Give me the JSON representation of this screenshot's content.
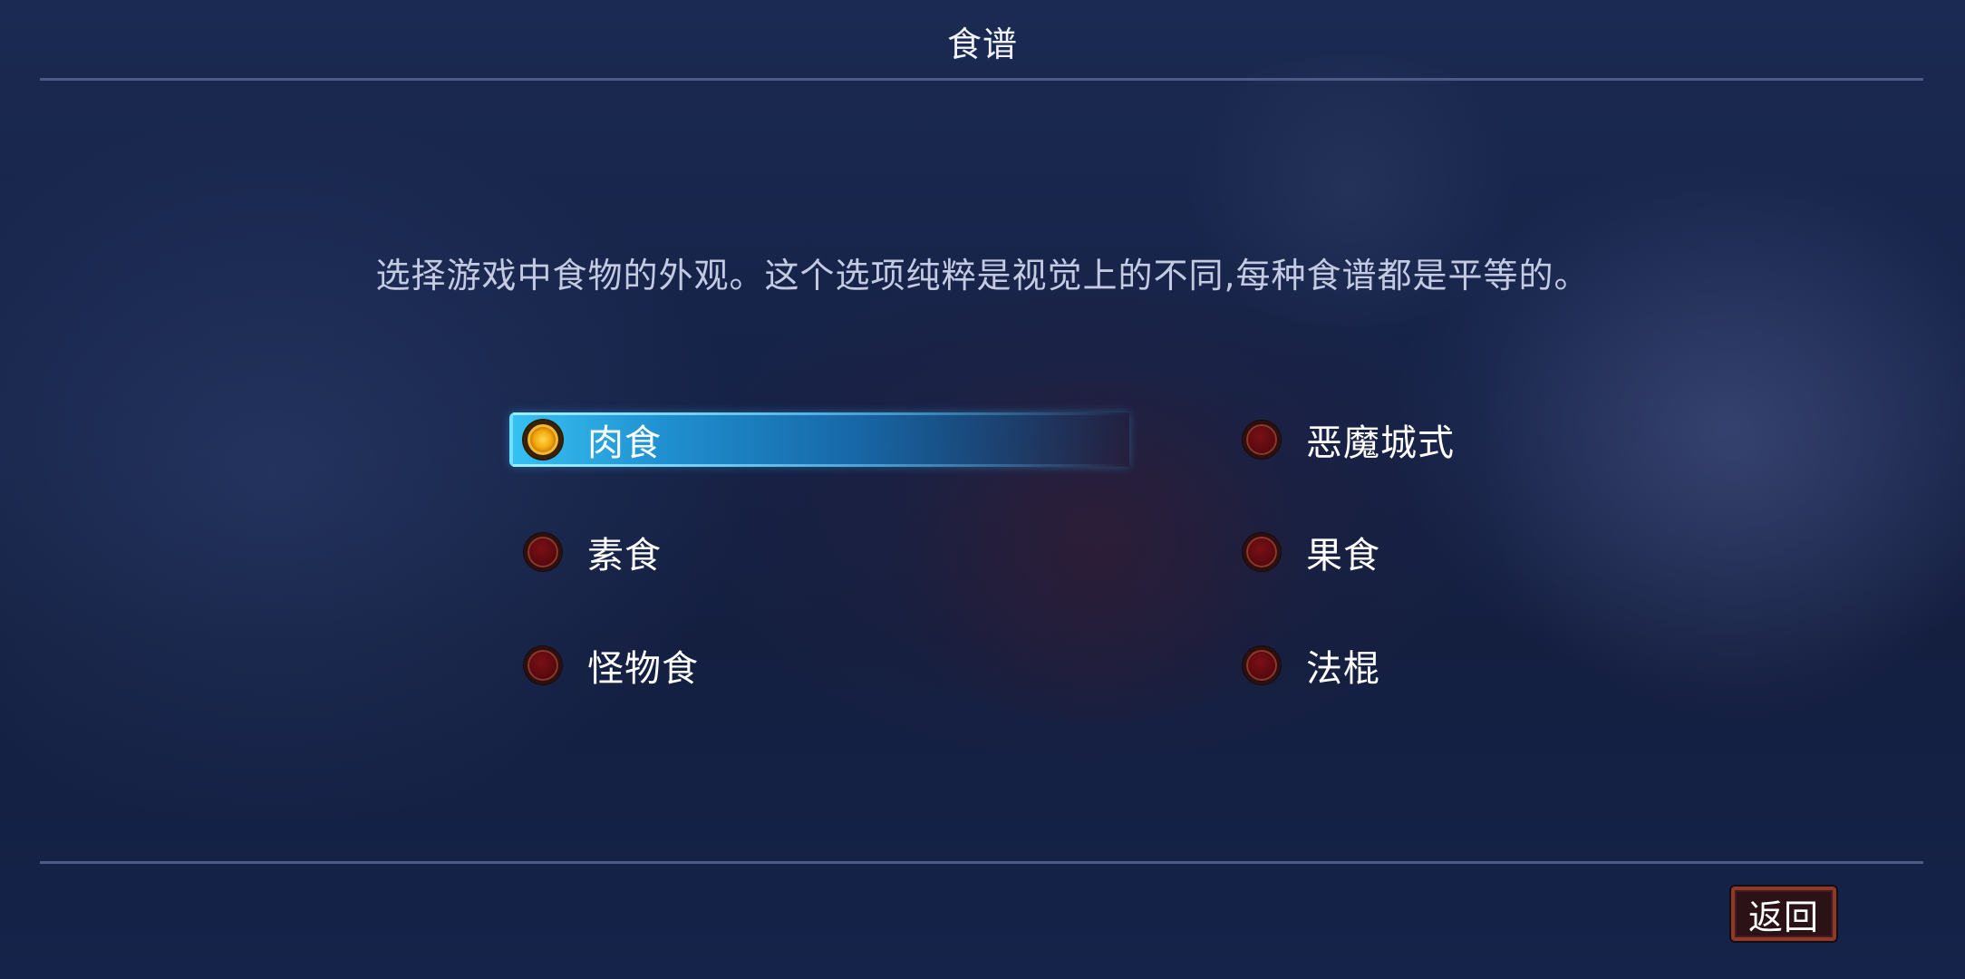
{
  "header": {
    "title": "食谱"
  },
  "description": "选择游戏中食物的外观。这个选项纯粹是视觉上的不同,每种食谱都是平等的。",
  "options": [
    {
      "label": "肉食",
      "selected": true
    },
    {
      "label": "素食",
      "selected": false
    },
    {
      "label": "怪物食",
      "selected": false
    },
    {
      "label": "恶魔城式",
      "selected": false
    },
    {
      "label": "果食",
      "selected": false
    },
    {
      "label": "法棍",
      "selected": false
    }
  ],
  "footer": {
    "back_label": "返回"
  },
  "colors": {
    "background": "#17244a",
    "highlight": "#1f8fcf",
    "radio_selected": "#f2a80f",
    "radio_unselected": "#5b0a0f",
    "back_button_border": "#8a3a2e"
  },
  "icons": {
    "radio_selected": "radio-selected-icon",
    "radio_unselected": "radio-unselected-icon"
  }
}
